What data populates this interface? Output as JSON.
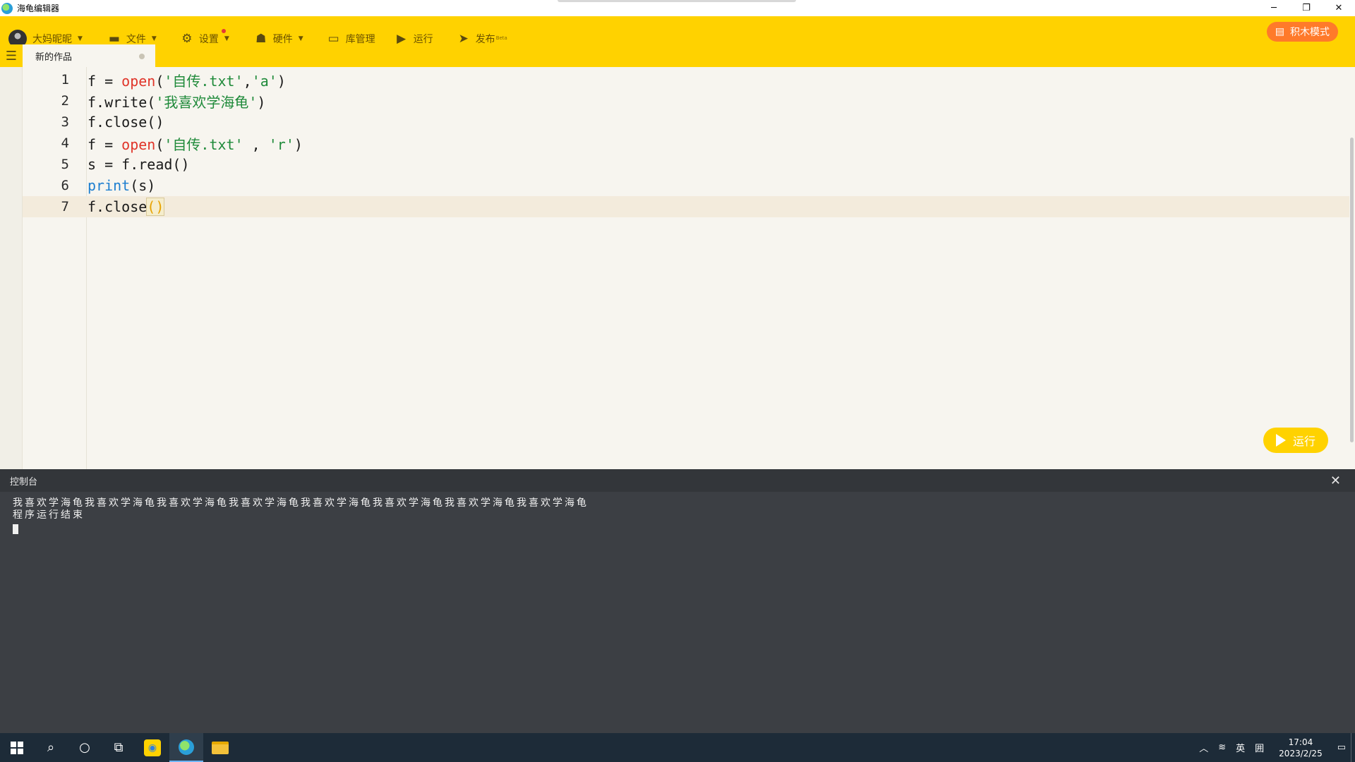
{
  "window": {
    "title": "海龟编辑器",
    "minimize": "─",
    "restore": "❐",
    "close": "✕"
  },
  "toolbar": {
    "user_name": "大妈昵昵",
    "file": "文件",
    "settings": "设置",
    "hardware": "硬件",
    "library": "库管理",
    "run": "运行",
    "publish": "发布",
    "publish_beta": "Beta",
    "block_mode": "积木模式"
  },
  "tabs": [
    {
      "label": "新的作品"
    }
  ],
  "editor": {
    "lines": [
      {
        "num": "1"
      },
      {
        "num": "2"
      },
      {
        "num": "3"
      },
      {
        "num": "4"
      },
      {
        "num": "5"
      },
      {
        "num": "6"
      },
      {
        "num": "7"
      }
    ],
    "tokens": {
      "l1a": "f = ",
      "l1b": "open",
      "l1c": "(",
      "l1d": "'自传.txt'",
      "l1e": ",",
      "l1f": "'a'",
      "l1g": ")",
      "l2a": "f.write(",
      "l2b": "'我喜欢学海龟'",
      "l2c": ")",
      "l3a": "f.close()",
      "l4a": "f = ",
      "l4b": "open",
      "l4c": "(",
      "l4d": "'自传.txt'",
      "l4e": " , ",
      "l4f": "'r'",
      "l4g": ")",
      "l5a": "s = f.read()",
      "l6a": "print",
      "l6b": "(s)",
      "l7a": "f.close",
      "l7b": "()"
    },
    "run_button": "运行"
  },
  "console": {
    "title": "控制台",
    "close": "✕",
    "output_line1": "我喜欢学海龟我喜欢学海龟我喜欢学海龟我喜欢学海龟我喜欢学海龟我喜欢学海龟我喜欢学海龟我喜欢学海龟",
    "output_line2": "程序运行结束"
  },
  "taskbar": {
    "ime_lang": "英",
    "ime_mode": "囲",
    "time": "17:04",
    "date": "2023/2/25"
  }
}
